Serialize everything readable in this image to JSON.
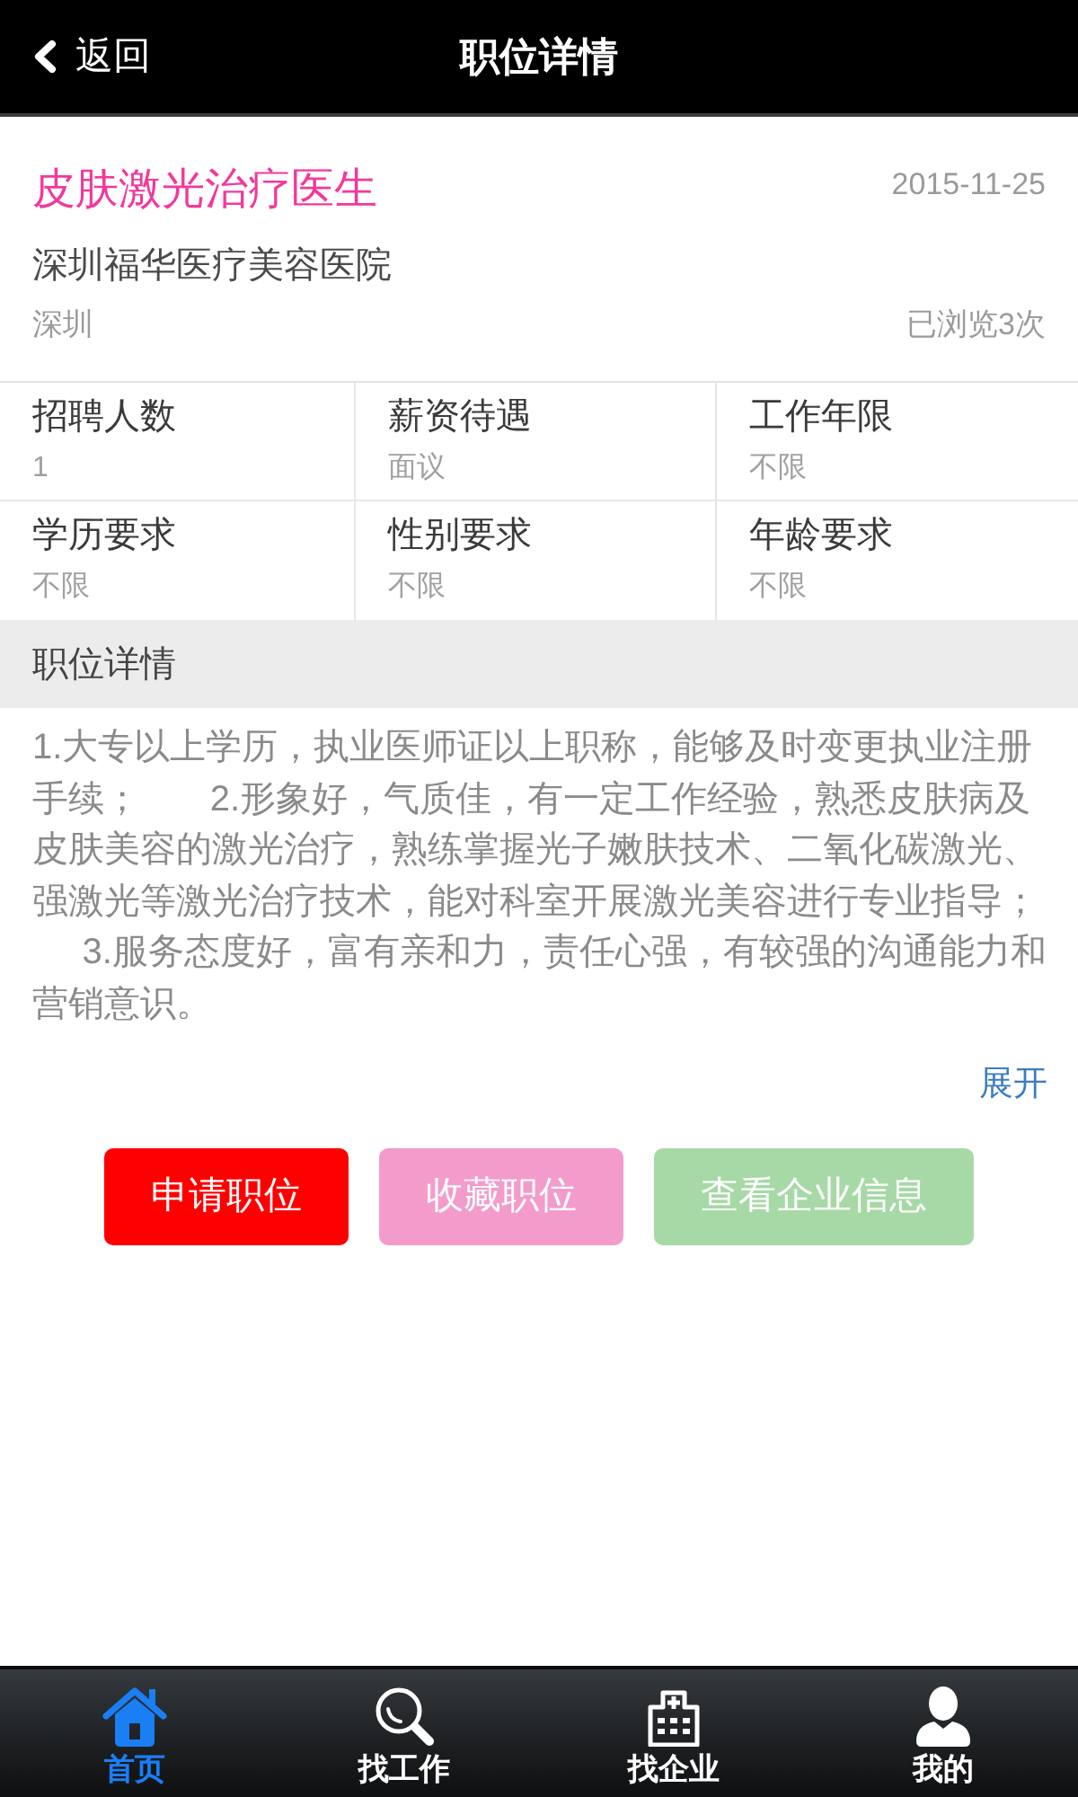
{
  "header": {
    "back_label": "返回",
    "title": "职位详情"
  },
  "job": {
    "title": "皮肤激光治疗医生",
    "date": "2015-11-25",
    "company": "深圳福华医疗美容医院",
    "city": "深圳",
    "views": "已浏览3次"
  },
  "requirements": [
    {
      "label": "招聘人数",
      "value": "1"
    },
    {
      "label": "薪资待遇",
      "value": "面议"
    },
    {
      "label": "工作年限",
      "value": "不限"
    },
    {
      "label": "学历要求",
      "value": "不限"
    },
    {
      "label": "性别要求",
      "value": "不限"
    },
    {
      "label": "年龄要求",
      "value": "不限"
    }
  ],
  "details": {
    "heading": "职位详情",
    "text": "1.大专以上学历，执业医师证以上职称，能够及时变更执业注册手续；       2.形象好，气质佳，有一定工作经验，熟悉皮肤病及皮肤美容的激光治疗，熟练掌握光子嫩肤技术、二氧化碳激光、强激光等激光治疗技术，能对科室开展激光美容进行专业指导；       3.服务态度好，富有亲和力，责任心强，有较强的沟通能力和营销意识。",
    "expand_label": "展开"
  },
  "actions": [
    {
      "label": "申请职位",
      "color": "#ff0000"
    },
    {
      "label": "收藏职位",
      "color": "#f39ccb"
    },
    {
      "label": "查看企业信息",
      "color": "#a6d9a6"
    }
  ],
  "tab_bar": [
    {
      "label": "首页",
      "kind": "home",
      "selected": true
    },
    {
      "label": "找工作",
      "kind": "search",
      "selected": false
    },
    {
      "label": "找企业",
      "kind": "company",
      "selected": false
    },
    {
      "label": "我的",
      "kind": "profile",
      "selected": false
    }
  ]
}
